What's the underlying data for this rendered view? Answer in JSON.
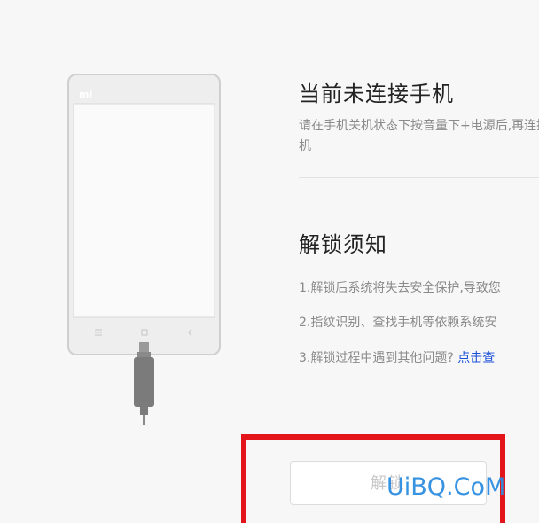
{
  "phone": {
    "brand_logo": "mi"
  },
  "status": {
    "title": "当前未连接手机",
    "description": "请在手机关机状态下按音量下+电源后,再连接手机"
  },
  "notice": {
    "title": "解锁须知",
    "item1": "1.解锁后系统将失去安全保护,导致您",
    "item2": "2.指纹识别、查找手机等依赖系统安",
    "item3_text": "3.解锁过程中遇到其他问题?",
    "item3_link": "点击查"
  },
  "unlock_button": {
    "label": "解锁"
  },
  "watermark": {
    "text": "UiBQ.CoM"
  },
  "colors": {
    "highlight": "#e3141a",
    "link": "#1a4fd8",
    "watermark": "#2d8de0"
  },
  "icons": {
    "phone_nav": [
      "menu-icon",
      "home-icon",
      "back-icon"
    ],
    "cable": "usb-cable-icon"
  }
}
